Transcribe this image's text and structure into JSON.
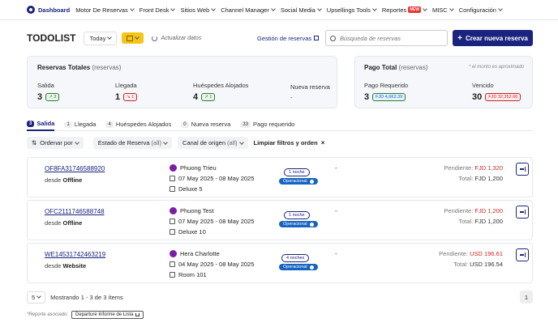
{
  "nav": {
    "items": [
      {
        "label": "Dashboard",
        "active": true,
        "chevron": false
      },
      {
        "label": "Motor De Reservas",
        "chevron": true
      },
      {
        "label": "Front Desk",
        "chevron": true
      },
      {
        "label": "Sitios Web",
        "chevron": true
      },
      {
        "label": "Channel Manager",
        "chevron": true
      },
      {
        "label": "Social Media",
        "chevron": true
      },
      {
        "label": "Upsellings Tools",
        "chevron": true
      },
      {
        "label": "Reportes",
        "badge": "NEW",
        "chevron": true
      },
      {
        "label": "MISC",
        "chevron": true
      },
      {
        "label": "Configuración",
        "chevron": true
      }
    ]
  },
  "toolbar": {
    "title": "TODOLIST",
    "today": "Today",
    "update": "Actualizar datos",
    "gestion": "Gestión de reservas",
    "search_placeholder": "Búsqueda de reservas",
    "create": "Crear nueva reserva"
  },
  "totals": {
    "title": "Reservas Totales",
    "title_sub": "(reservas)",
    "stats": [
      {
        "label": "Salida",
        "value": "3",
        "pill": "3",
        "pill_color": "green"
      },
      {
        "label": "Llegada",
        "value": "1",
        "pill": "1",
        "pill_color": "red"
      },
      {
        "label": "Huéspedes Alojados",
        "value": "4",
        "pill": "1",
        "pill_color": "green"
      },
      {
        "label": "Nueva reserva",
        "value": "-"
      }
    ]
  },
  "payment": {
    "title": "Pago Total",
    "title_sub": "(reservas)",
    "note": "* el monto es aproximado",
    "requerido": {
      "label": "Pago Requerido",
      "value": "3",
      "amount": "FJD 4,662.39"
    },
    "vencido": {
      "label": "Vencido",
      "value": "30",
      "amount": "FJD 32,352.66"
    }
  },
  "tabs": [
    {
      "count": "3",
      "label": "Salida",
      "active": true
    },
    {
      "count": "1",
      "label": "Llegada"
    },
    {
      "count": "4",
      "label": "Huéspedes Alojados"
    },
    {
      "count": "0",
      "label": "Nueva reserva"
    },
    {
      "count": "33",
      "label": "Pago requerido"
    }
  ],
  "filters": {
    "order": "Ordenar por",
    "estado": "Estado de Reserva",
    "estado_sub": "(all)",
    "canal": "Canal de origen",
    "canal_sub": "(all)",
    "clear": "Limpiar filtros y orden"
  },
  "reservations": [
    {
      "code": "OF8FA31746588920",
      "desde": "desde",
      "source": "Offline",
      "guest": "Phuong Trieu",
      "dates": "07 May 2025 - 08 May 2025",
      "room": "Deluxe 5",
      "nights": "1 noche",
      "status": "Operacional",
      "note": "-",
      "pending_label": "Pendiente:",
      "pending": "FJD 1,320",
      "total_label": "Total:",
      "total": "FJD 1,200"
    },
    {
      "code": "OFC2111746588748",
      "desde": "desde",
      "source": "Offline",
      "guest": "Phuong Test",
      "dates": "07 May 2025 - 08 May 2025",
      "room": "Deluxe 10",
      "nights": "1 noche",
      "status": "Operacional",
      "note": "-",
      "pending_label": "Pendiente:",
      "pending": "FJD 1,200",
      "total_label": "Total:",
      "total": "FJD 1,200"
    },
    {
      "code": "WE14531742463219",
      "desde": "desde",
      "source": "Website",
      "guest": "Hera Charlotte",
      "dates": "04 May 2025 - 08 May 2025",
      "room": "Room 101",
      "nights": "4 noches",
      "status": "Operacional",
      "note": "-",
      "pending_label": "Pendiente:",
      "pending": "USD 196.61",
      "total_label": "Total:",
      "total": "USD 196.54"
    }
  ],
  "pager": {
    "per_page": "5",
    "showing": "Mostrando 1 - 3 de 3 ítems",
    "page": "1"
  },
  "report": {
    "label": "*Reporte asociado:",
    "button": "Departure Informe de Lista"
  },
  "colors": {
    "brand": "#1a237e",
    "accent": "#f5c518",
    "danger": "#c62828",
    "success": "#2e7d32"
  }
}
